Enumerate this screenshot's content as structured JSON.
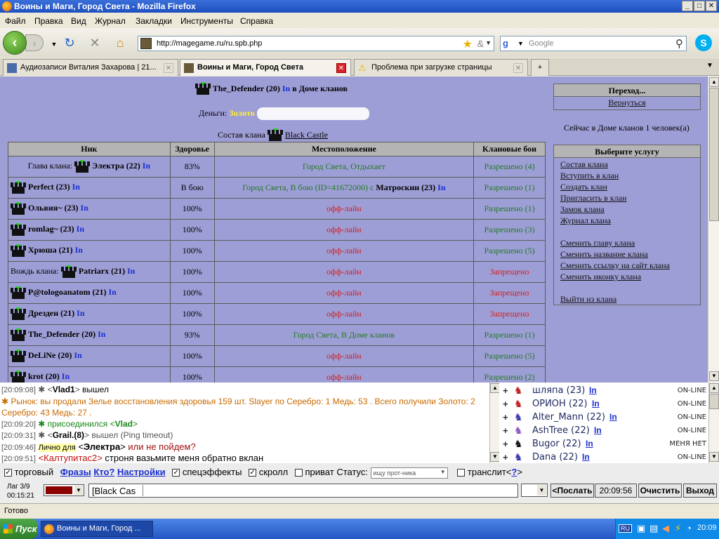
{
  "window": {
    "title": "Воины и Маги, Город Света - Mozilla Firefox",
    "min": "_",
    "max": "□",
    "close": "✕"
  },
  "menu": [
    "Файл",
    "Правка",
    "Вид",
    "Журнал",
    "Закладки",
    "Инструменты",
    "Справка"
  ],
  "nav": {
    "url": "http://magegame.ru/ru.spb.php",
    "search_placeholder": "Google"
  },
  "tabs": [
    {
      "label": "Аудиозаписи Виталия Захарова | 21...",
      "active": false
    },
    {
      "label": "Воины и Маги, Город Света",
      "active": true
    },
    {
      "label": "Проблема при загрузке страницы",
      "active": false
    }
  ],
  "page": {
    "header_nick": "The_Defender (20)",
    "header_info": "In",
    "header_suffix": " в Доме кланов",
    "money_label": "Деньги:",
    "money_value": "Золото",
    "clan_label": "Состав клана",
    "clan_name": "Black Castle",
    "columns": [
      "Ник",
      "Здоровье",
      "Местоположение",
      "Клановые бои"
    ],
    "rows": [
      {
        "prefix": "Глава клана: ",
        "nick": "Электра (22)",
        "hp": "83%",
        "loc": "Город Света, Отдыхает",
        "loc_color": "green",
        "loc_extra": "",
        "loc_extra_nick": "",
        "fight": "Разрешено (4)",
        "fight_color": "green"
      },
      {
        "prefix": "",
        "nick": "Perfect (23)",
        "hp": "В бою",
        "loc": "Город Света, В бою (ID=41672000) с ",
        "loc_color": "green",
        "loc_extra_nick": "Матроскин (23)",
        "fight": "Разрешено (1)",
        "fight_color": "green"
      },
      {
        "prefix": "",
        "nick": "Ольвия~ (23)",
        "hp": "100%",
        "loc": "офф-лайн",
        "loc_color": "red",
        "loc_extra_nick": "",
        "fight": "Разрешено (1)",
        "fight_color": "green"
      },
      {
        "prefix": "",
        "nick": "romlag~ (23)",
        "hp": "100%",
        "loc": "офф-лайн",
        "loc_color": "red",
        "loc_extra_nick": "",
        "fight": "Разрешено (3)",
        "fight_color": "green"
      },
      {
        "prefix": "",
        "nick": "Хрюша (21)",
        "hp": "100%",
        "loc": "офф-лайн",
        "loc_color": "red",
        "loc_extra_nick": "",
        "fight": "Разрешено (5)",
        "fight_color": "green"
      },
      {
        "prefix": "Вождь клана: ",
        "nick": "Patriarx (21)",
        "hp": "100%",
        "loc": "офф-лайн",
        "loc_color": "red",
        "loc_extra_nick": "",
        "fight": "Запрещено",
        "fight_color": "red"
      },
      {
        "prefix": "",
        "nick": "P@tologoanatom (21)",
        "hp": "100%",
        "loc": "офф-лайн",
        "loc_color": "red",
        "loc_extra_nick": "",
        "fight": "Запрещено",
        "fight_color": "red"
      },
      {
        "prefix": "",
        "nick": "Дрезден (21)",
        "hp": "100%",
        "loc": "офф-лайн",
        "loc_color": "red",
        "loc_extra_nick": "",
        "fight": "Запрещено",
        "fight_color": "red"
      },
      {
        "prefix": "",
        "nick": "The_Defender (20)",
        "hp": "93%",
        "loc": "Город Света, В Доме кланов",
        "loc_color": "green",
        "loc_extra_nick": "",
        "fight": "Разрешено (1)",
        "fight_color": "green"
      },
      {
        "prefix": "",
        "nick": "DeLiNe (20)",
        "hp": "100%",
        "loc": "офф-лайн",
        "loc_color": "red",
        "loc_extra_nick": "",
        "fight": "Разрешено (5)",
        "fight_color": "green"
      },
      {
        "prefix": "",
        "nick": "krot (20)",
        "hp": "100%",
        "loc": "офф-лайн",
        "loc_color": "red",
        "loc_extra_nick": "",
        "fight": "Разрешено (2)",
        "fight_color": "green"
      }
    ],
    "info_link": "In",
    "nav_panel": {
      "title": "Переход...",
      "link": "Вернуться"
    },
    "house_status": "Сейчас в Доме кланов 1 человек(а)",
    "services": {
      "title": "Выберите услугу",
      "group1": [
        "Состав клана",
        "Вступить в клан",
        "Создать клан",
        "Пригласить в клан",
        "Замок клана",
        "Журнал клана"
      ],
      "group2": [
        "Сменить главу клана",
        "Сменить название клана",
        "Сменить ссылку на сайт клана",
        "Сменить иконку клана"
      ],
      "group3": [
        "Выйти из клана"
      ]
    }
  },
  "chat": {
    "l1_ts": "[20:09:08]",
    "l1_nick": "Vlad1",
    "l1_text": " вышел",
    "l2_text": "Рынок: вы продали Зелье восстановления здоровья 159 шт. Slayer по Серебро: 1 Медь: 53 . Всего получили Золото: 2",
    "l2b_text": "Серебро: 43 Медь: 27 .",
    "l3_ts": "[20:09:20]",
    "l3_text": "присоединился <",
    "l3_nick": "Vlad",
    "l4_ts": "[20:09:31]",
    "l4_nick": "Grail.(8)",
    "l4_text": " вышел (Ping timeout)",
    "l5_ts": "[20:09:46]",
    "l5_private": "Лично для",
    "l5_nick": "Электра",
    "l5_text": " или не пойдем?",
    "l6_ts": "[20:09:51]",
    "l6_nick": "Калтупитас2",
    "l6_text": " строня вазьмите меня обратно вклан"
  },
  "users": [
    {
      "name": "шляпа (23)",
      "status": "ON-LINE"
    },
    {
      "name": "ОРИОН (22)",
      "status": "ON-LINE"
    },
    {
      "name": "Alter_Mann (22)",
      "status": "ON-LINE"
    },
    {
      "name": "AshTree (22)",
      "status": "ON-LINE"
    },
    {
      "name": "Bugor (22)",
      "status": "МЕНЯ НЕТ"
    },
    {
      "name": "Dana (22)",
      "status": "ON-LINE"
    }
  ],
  "controls": {
    "trade": "торговый",
    "phrases": "Фразы",
    "who": "Кто?",
    "settings": "Настройки",
    "effects": "спецэффекты",
    "scroll": "скролл",
    "private": "приват",
    "status_label": "Статус:",
    "status_value": "ищу прот-ника",
    "translit": "транслит<",
    "translit_q": "?",
    "translit_end": ">",
    "lag": "Лаг 3/9",
    "time_left": "00:15:21",
    "chat_prefix": "[Black Cas",
    "send": "<Послать",
    "clock": "20:09:56",
    "clear": "Очистить",
    "exit": "Выход"
  },
  "statusbar": "Готово",
  "taskbar": {
    "start": "Пуск",
    "item": "Воины и Маги, Город ...",
    "lang": "RU",
    "time": "20:09"
  },
  "colors": {
    "page_bg": "#9e9ed6",
    "header_gray": "#b4b4b4",
    "online_green": "#1f7a1f",
    "offline_red": "#d21f1f",
    "link_blue": "#1a2fd0"
  }
}
